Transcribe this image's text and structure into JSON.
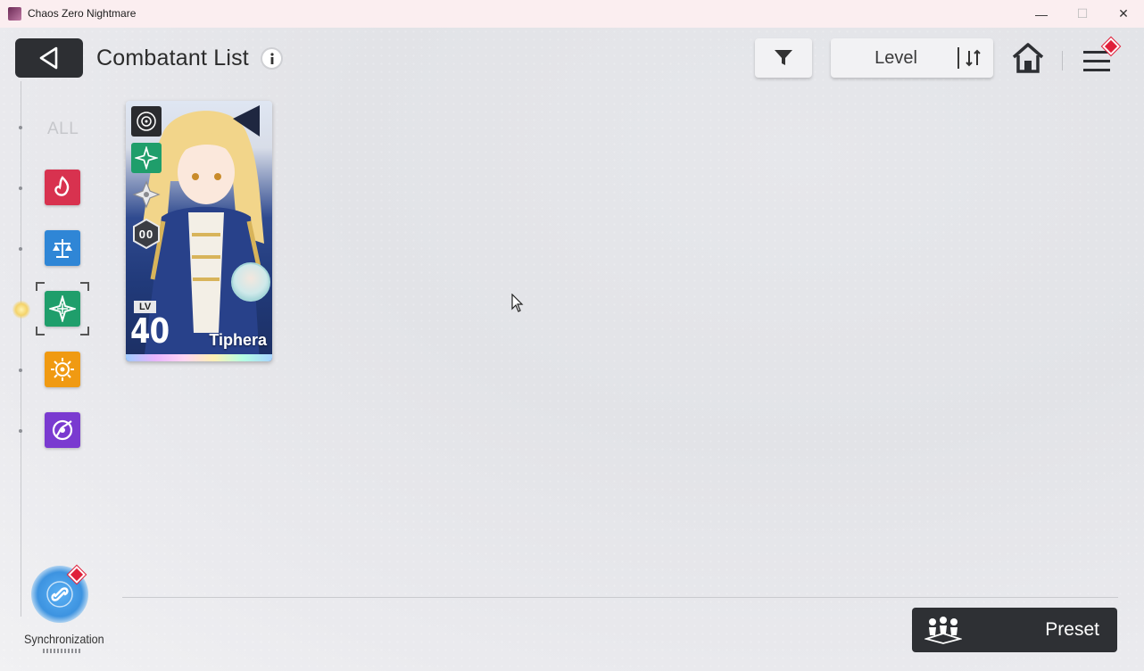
{
  "window": {
    "title": "Chaos Zero Nightmare",
    "controls": {
      "minimize": "—",
      "maximize": "☐",
      "close": "✕"
    }
  },
  "header": {
    "title": "Combatant List",
    "info_icon": "info-icon",
    "back_icon": "back-arrow-icon",
    "filter_icon": "funnel-icon",
    "sort": {
      "label": "Level",
      "icon": "sort-order-icon"
    },
    "home_icon": "home-icon",
    "menu_icon": "hamburger-menu-icon"
  },
  "class_filter": {
    "all_label": "ALL",
    "active": "emerald-class",
    "items": [
      {
        "name": "crimson-class",
        "color": "#d8324f"
      },
      {
        "name": "scales-class",
        "color": "#2f86d6"
      },
      {
        "name": "emerald-class",
        "color": "#1f9e6b"
      },
      {
        "name": "sun-class",
        "color": "#f09a12"
      },
      {
        "name": "void-class",
        "color": "#7a3ad0"
      }
    ]
  },
  "combatants": [
    {
      "name": "Tiphera",
      "level_label": "LV",
      "level": "40",
      "icons": [
        "target-icon",
        "emerald-class-icon",
        "shuriken-icon",
        "rank-icon"
      ],
      "rank_text": "00"
    }
  ],
  "footer": {
    "sync_label": "Synchronization",
    "preset_label": "Preset"
  },
  "colors": {
    "dark_button": "#2e3034",
    "badge_red": "#e0203a",
    "accent_blue": "#3d93e0"
  }
}
